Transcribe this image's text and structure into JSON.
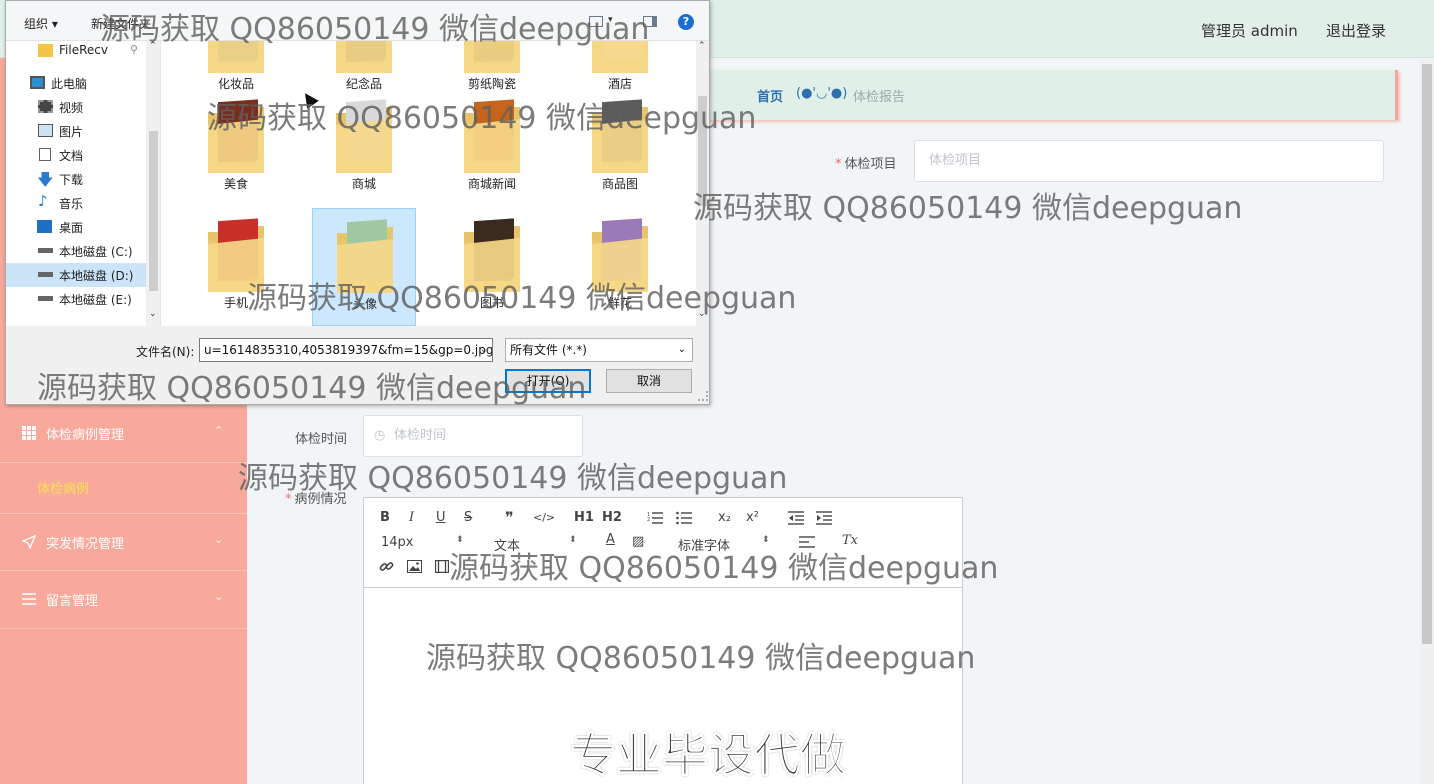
{
  "header": {
    "user_label": "管理员 admin",
    "logout_label": "退出登录"
  },
  "sidebar": {
    "items": [
      {
        "label": "体检病例管理",
        "icon": "grid-icon",
        "chevron": "⌃"
      },
      {
        "label": "突发情况管理",
        "icon": "send-icon",
        "chevron": "⌄"
      },
      {
        "label": "留言管理",
        "icon": "list-icon",
        "chevron": "⌄"
      }
    ],
    "active_sub": "体检病例"
  },
  "breadcrumb": {
    "home": "首页",
    "face": "(●'◡'●)",
    "current": "体检报告"
  },
  "form": {
    "project_label": "体检项目",
    "project_placeholder": "体检项目",
    "time_label": "体检时间",
    "time_placeholder": "体检时间",
    "case_label": "病例情况",
    "required_mark": "*"
  },
  "editor": {
    "font_size": "14px",
    "block_type": "文本",
    "font_family": "标准字体",
    "content_banner": "专业毕设代做",
    "buttons": [
      "B",
      "I",
      "U",
      "S",
      "❞",
      "</>",
      "H1",
      "H2",
      "ol",
      "ul",
      "x₂",
      "x²",
      "outdent",
      "indent",
      "A",
      "bg",
      "align",
      "Tx",
      "link",
      "image",
      "video"
    ]
  },
  "dialog": {
    "organize_label": "组织 ▾",
    "new_folder_label": "新建文件夹",
    "help_label": "?",
    "nav": [
      {
        "label": "FileRecv",
        "icon": "folder-icon",
        "pinned": true
      },
      {
        "label": "此电脑",
        "icon": "computer-icon"
      },
      {
        "label": "视频",
        "icon": "video-icon"
      },
      {
        "label": "图片",
        "icon": "picture-icon"
      },
      {
        "label": "文档",
        "icon": "document-icon"
      },
      {
        "label": "下载",
        "icon": "download-icon"
      },
      {
        "label": "音乐",
        "icon": "music-icon"
      },
      {
        "label": "桌面",
        "icon": "desktop-icon"
      },
      {
        "label": "本地磁盘 (C:)",
        "icon": "drive-icon"
      },
      {
        "label": "本地磁盘 (D:)",
        "icon": "drive-icon",
        "selected": true
      },
      {
        "label": "本地磁盘 (E:)",
        "icon": "drive-icon"
      }
    ],
    "folders": [
      {
        "name": "化妆品",
        "color": "#5a6b7a"
      },
      {
        "name": "纪念品",
        "color": "#444444"
      },
      {
        "name": "剪纸陶瓷",
        "color": "#6b4a2a"
      },
      {
        "name": "酒店",
        "color": "#e8e2d8"
      },
      {
        "name": "美食",
        "color": "#7a2e1e"
      },
      {
        "name": "商城",
        "color": "#d9d9d9"
      },
      {
        "name": "商城新闻",
        "color": "#c7641d"
      },
      {
        "name": "商品图",
        "color": "#5c5c5c"
      },
      {
        "name": "手机",
        "color": "#c8302a"
      },
      {
        "name": "头像",
        "color": "#9fc9a0",
        "selected": true
      },
      {
        "name": "图书",
        "color": "#3a2b1f"
      },
      {
        "name": "鲜花",
        "color": "#9a7ab8"
      }
    ],
    "filename_label": "文件名(N):",
    "filename_value": "u=1614835310,4053819397&fm=15&gp=0.jpg",
    "filetype_value": "所有文件 (*.*)",
    "open_label": "打开(O)",
    "cancel_label": "取消"
  },
  "watermarks": [
    "源码获取 QQ86050149 微信deepguan",
    "源码获取 QQ86050149 微信deepguan",
    "源码获取 QQ86050149 微信deepguan",
    "源码获取 QQ86050149 微信deepguan",
    "源码获取 QQ86050149 微信deepguan",
    "源码获取 QQ86050149 微信deepguan",
    "源码获取 QQ86050149 微信deepguan",
    "源码获取 QQ86050149 微信deepguan"
  ]
}
